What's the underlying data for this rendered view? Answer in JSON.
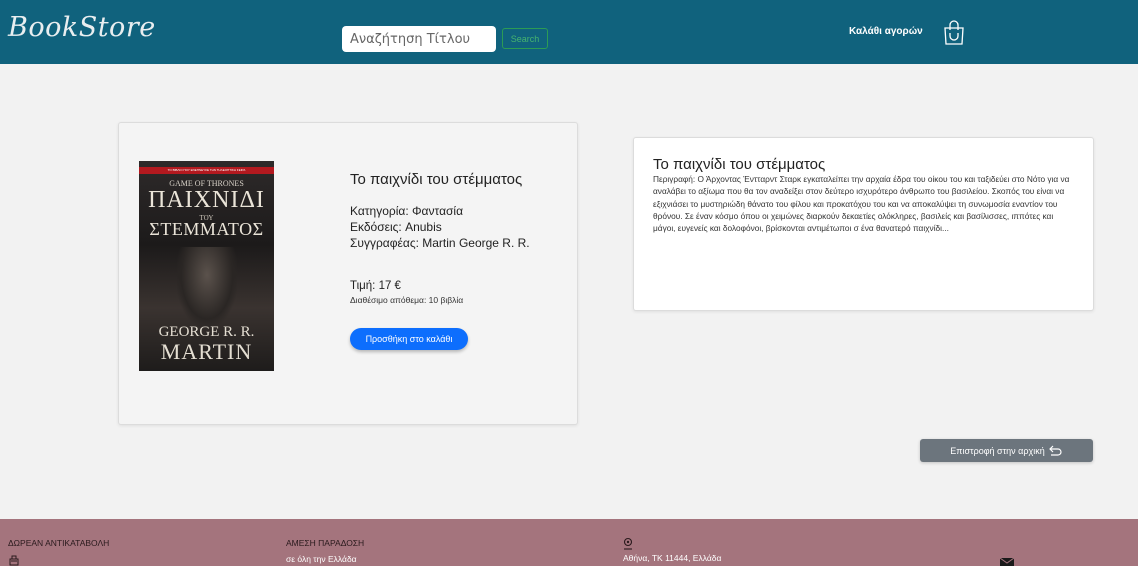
{
  "header": {
    "logo": "BookStore",
    "search_placeholder": "Αναζήτηση Τίτλου",
    "search_button": "Search",
    "cart_label": "Καλάθι αγορών",
    "cart_icon": "shopping-bag-icon"
  },
  "product": {
    "cover": {
      "banner": "ΤΟ ΒΙΒΛΙΟ ΠΟΥ ΕΝΕΠΝΕΥΣΕ ΤΗΝ ΤΗΛΕΟΠΤΙΚΗ ΣΕΙΡΑ",
      "series": "GAME OF THRONES",
      "title_1": "ΠΑΙΧΝΙΔΙ",
      "title_2": "ΤΟΥ",
      "title_3": "ΣΤΕΜΜΑΤΟΣ",
      "author_1": "GEORGE R. R.",
      "author_2": "MARTIN"
    },
    "title": "Το παιχνίδι του στέμματος",
    "category": "Κατηγορία: Φαντασία",
    "publisher": "Εκδόσεις: Anubis",
    "author": "Συγγραφέας: Martin George R. R.",
    "price": "Τιμή: 17 €",
    "stock": "Διαθέσιμο απόθεμα: 10 βιβλία",
    "add_button": "Προσθήκη στο καλάθι"
  },
  "description": {
    "title": "Το παιχνίδι του στέμματος",
    "text": "Περιγραφή: Ο Άρχοντας Έντταρντ Σταρκ εγκαταλείπει την αρχαία έδρα του οίκου του και ταξιδεύει στο Νότο για να αναλάβει το αξίωμα που θα τον αναδείξει στον δεύτερο ισχυρότερο άνθρωπο του βασιλείου. Σκοπός του είναι να εξιχνιάσει το μυστηριώδη θάνατο του φίλου και προκατόχου του και να αποκαλύψει τη συνωμοσία εναντίον του θρόνου. Σε έναν κόσμο όπου οι χειμώνες διαρκούν δεκαετίες ολόκληρες, βασιλείς και βασίλισσες, ιππότες και μάγοι, ευγενείς και δολοφόνοι, βρίσκονται αντιμέτωποι σ ένα θανατερό παιχνίδι..."
  },
  "back_button": "Επιστροφή στην αρχική",
  "footer": {
    "col1_heading": "ΔΩΡΕΑΝ ΑΝΤΙΚΑΤΑΒΟΛΗ",
    "col2_heading": "ΑΜΕΣΗ ΠΑΡΑΔΟΣΗ",
    "col2_text": "σε όλη την Ελλάδα",
    "address": "Αθήνα, ΤΚ 11444, Ελλάδα"
  }
}
